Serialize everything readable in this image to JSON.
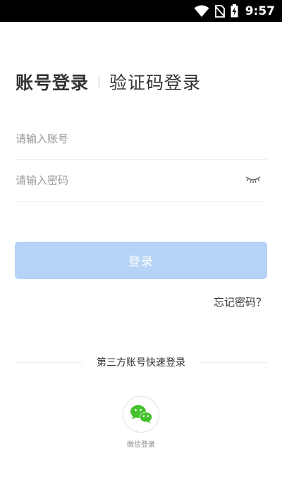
{
  "status_bar": {
    "time": "9:57",
    "icons": [
      "wifi-icon",
      "no-sim-icon",
      "battery-charging-icon"
    ]
  },
  "tabs": {
    "account_login": "账号登录",
    "code_login": "验证码登录"
  },
  "form": {
    "account_placeholder": "请输入账号",
    "account_value": "",
    "password_placeholder": "请输入密码",
    "password_value": "",
    "password_toggle_icon": "eye-closed-icon"
  },
  "login_button": {
    "label": "登录"
  },
  "forgot_password": {
    "label": "忘记密码？"
  },
  "third_party": {
    "title": "第三方账号快速登录",
    "wechat_label": "微信登录",
    "wechat_icon": "wechat-icon"
  },
  "colors": {
    "login_button_disabled": "#b6d3f5",
    "wechat_green": "#44c22b",
    "placeholder_gray": "#9a9a9a"
  }
}
